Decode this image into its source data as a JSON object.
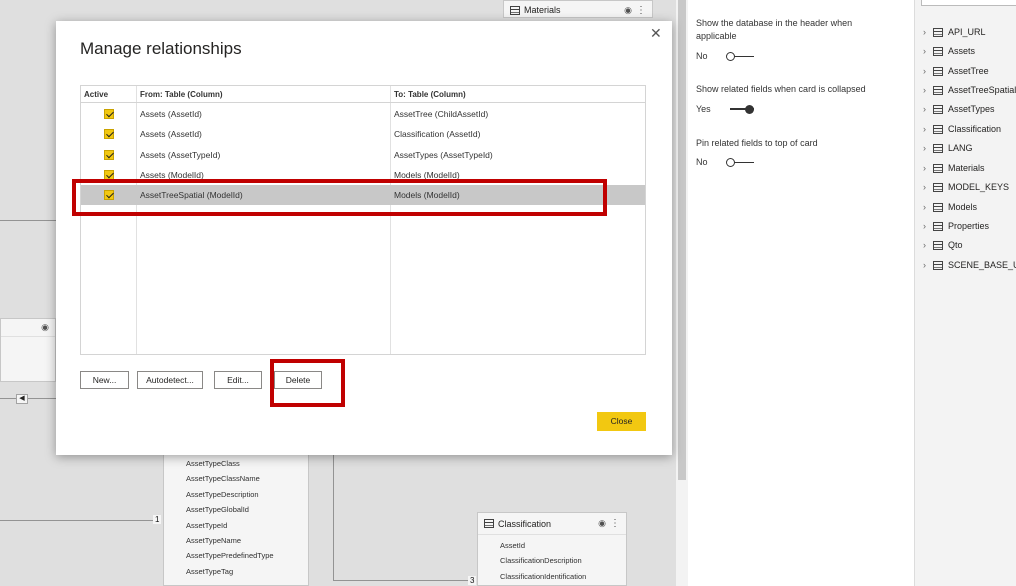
{
  "canvas": {
    "materials_card": {
      "title": "Materials"
    },
    "asset_type_card": {
      "fields": [
        "AssetTypeClass",
        "AssetTypeClassName",
        "AssetTypeDescription",
        "AssetTypeGlobalId",
        "AssetTypeId",
        "AssetTypeName",
        "AssetTypePredefinedType",
        "AssetTypeTag"
      ]
    },
    "classification_card": {
      "title": "Classification",
      "fields": [
        "AssetId",
        "ClassificationDescription",
        "ClassificationIdentification"
      ]
    },
    "cardinality_one": "1",
    "cardinality_three": "3"
  },
  "properties": {
    "show_database_label": "Show the database in the header when applicable",
    "show_database_state": "No",
    "show_related_label": "Show related fields when card is collapsed",
    "show_related_state": "Yes",
    "pin_related_label": "Pin related fields to top of card",
    "pin_related_state": "No"
  },
  "fields_pane": {
    "items": [
      "API_URL",
      "Assets",
      "AssetTree",
      "AssetTreeSpatial",
      "AssetTypes",
      "Classification",
      "LANG",
      "Materials",
      "MODEL_KEYS",
      "Models",
      "Properties",
      "Qto",
      "SCENE_BASE_URL"
    ]
  },
  "dialog": {
    "title": "Manage relationships",
    "columns": {
      "active": "Active",
      "from": "From: Table (Column)",
      "to": "To: Table (Column)"
    },
    "rows": [
      {
        "active": true,
        "from": "Assets (AssetId)",
        "to": "AssetTree (ChildAssetId)"
      },
      {
        "active": true,
        "from": "Assets (AssetId)",
        "to": "Classification (AssetId)"
      },
      {
        "active": true,
        "from": "Assets (AssetTypeId)",
        "to": "AssetTypes (AssetTypeId)"
      },
      {
        "active": true,
        "from": "Assets (ModelId)",
        "to": "Models (ModelId)"
      },
      {
        "active": true,
        "from": "AssetTreeSpatial (ModelId)",
        "to": "Models (ModelId)",
        "selected": true
      }
    ],
    "buttons": {
      "new": "New...",
      "autodetect": "Autodetect...",
      "edit": "Edit...",
      "delete": "Delete",
      "close": "Close"
    }
  },
  "colors": {
    "accent": "#f2c811",
    "highlight": "#c00000",
    "selected_row": "#c8c8c8"
  }
}
